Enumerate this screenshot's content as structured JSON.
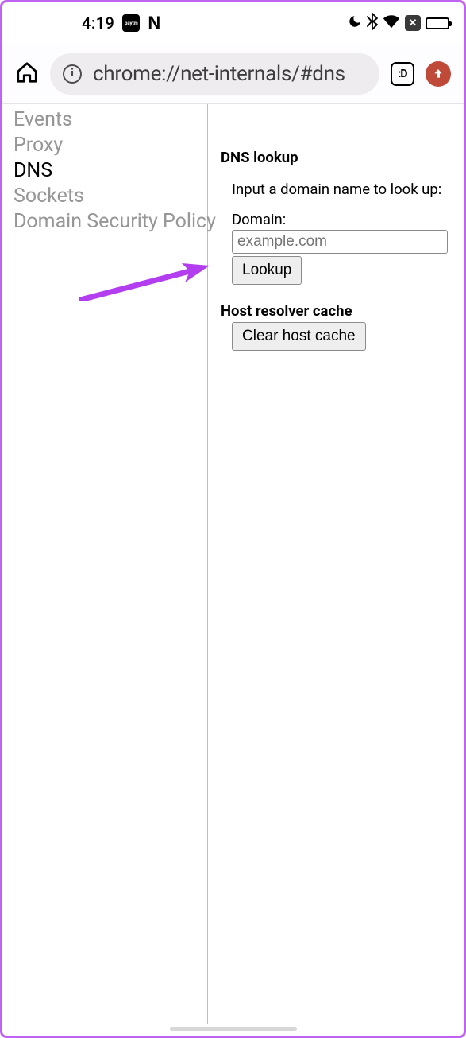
{
  "statusbar": {
    "time": "4:19",
    "paytm_label": "paytm",
    "n_label": "N"
  },
  "toolbar": {
    "url": "chrome://net-internals/#dns",
    "tabs_label": ":D"
  },
  "sidebar": {
    "items": [
      {
        "label": "Events",
        "active": false
      },
      {
        "label": "Proxy",
        "active": false
      },
      {
        "label": "DNS",
        "active": true
      },
      {
        "label": "Sockets",
        "active": false
      },
      {
        "label": "Domain Security Policy",
        "active": false
      }
    ]
  },
  "main": {
    "dns_lookup_title": "DNS lookup",
    "dns_instruction": "Input a domain name to look up:",
    "domain_label": "Domain:",
    "domain_placeholder": "example.com",
    "lookup_label": "Lookup",
    "host_cache_title": "Host resolver cache",
    "clear_cache_label": "Clear host cache"
  }
}
